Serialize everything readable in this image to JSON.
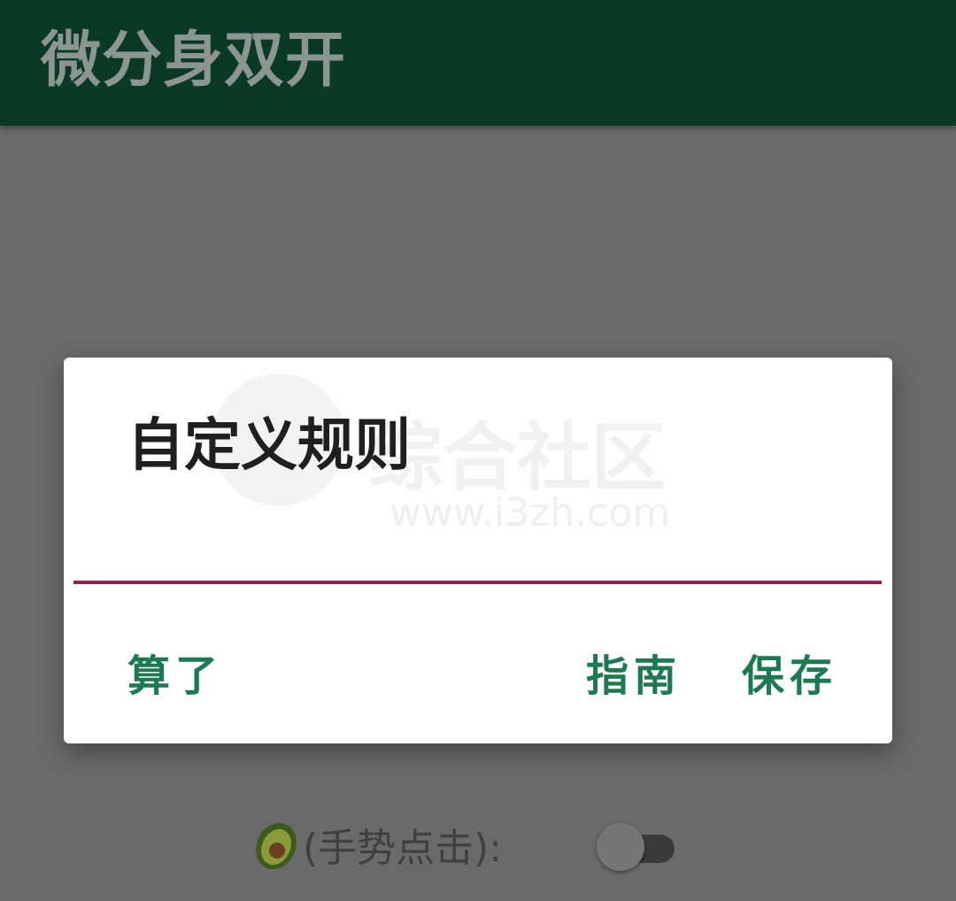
{
  "app_bar": {
    "title": "微分身双开"
  },
  "background": {
    "gesture_label": "(手势点击):",
    "gesture_toggle": "off",
    "icons": [
      "avocado-icon"
    ]
  },
  "dialog": {
    "title": "自定义规则",
    "input_value": "",
    "buttons": {
      "cancel": "算了",
      "guide": "指南",
      "save": "保存"
    },
    "watermark": {
      "text": "综合社区",
      "url": "www.i3zh.com"
    }
  },
  "colors": {
    "app_bar": "#0a3a26",
    "accent": "#1c7a52",
    "input_underline": "#9c1f5a",
    "scrim": "#6a6a6a"
  }
}
